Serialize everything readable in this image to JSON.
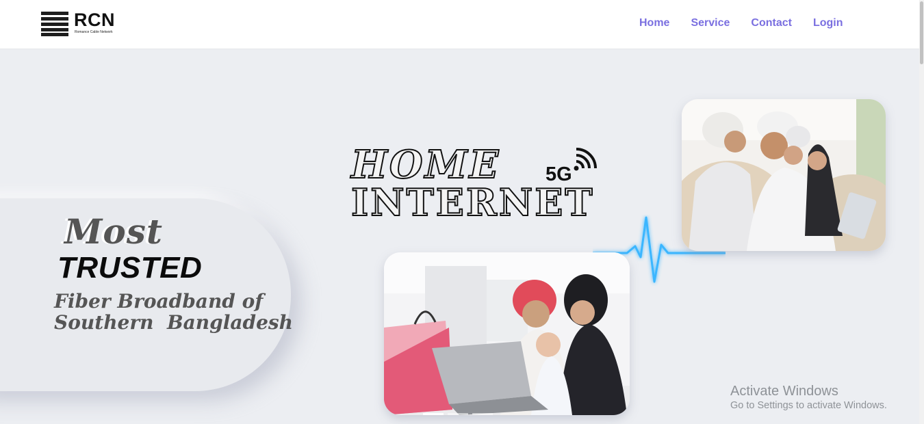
{
  "brand": {
    "name": "RCN",
    "tagline": "Romance Cable Network"
  },
  "nav": {
    "items": [
      {
        "label": "Home"
      },
      {
        "label": "Service"
      },
      {
        "label": "Contact"
      },
      {
        "label": "Login"
      }
    ],
    "color": "#7a6fe0"
  },
  "hero": {
    "word_most": "Most",
    "word_trusted": "TRUSTED",
    "line1": "Fiber Broadband of",
    "line2": "Southern  Bangladesh",
    "title_home": "HOME",
    "title_internet": "INTERNET",
    "badge_5g": "5G",
    "carousel_slides": 3,
    "carousel_active": 1
  },
  "icons": {
    "logo": "stacked-bars-icon",
    "signal": "wifi-signal-icon",
    "pulse": "heartbeat-line-icon"
  },
  "windows_watermark": {
    "title": "Activate Windows",
    "subtitle": "Go to Settings to activate Windows."
  },
  "colors": {
    "background": "#eceef2",
    "accent": "#7a6fe0",
    "pulse": "#3ab6ff"
  }
}
